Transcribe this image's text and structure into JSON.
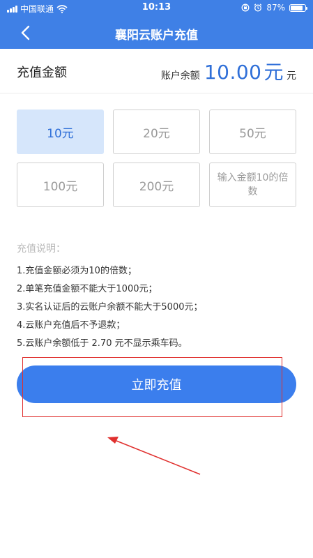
{
  "status_bar": {
    "carrier": "中国联通",
    "time": "10:13",
    "battery": "87%",
    "battery_level": 0.87,
    "icons": [
      "signal-icon",
      "wifi-icon",
      "rotation-lock-icon",
      "alarm-icon",
      "battery-icon"
    ]
  },
  "nav": {
    "title": "襄阳云账户充值",
    "back_icon": "chevron-left-icon"
  },
  "amount": {
    "label": "充值金额",
    "balance_label": "账户余额",
    "balance_value": "10.00",
    "balance_unit_large": "元",
    "balance_unit": "元"
  },
  "options": [
    {
      "label": "10元",
      "selected": true
    },
    {
      "label": "20元",
      "selected": false
    },
    {
      "label": "50元",
      "selected": false
    },
    {
      "label": "100元",
      "selected": false
    },
    {
      "label": "200元",
      "selected": false
    },
    {
      "label": "输入金额10的倍数",
      "selected": false
    }
  ],
  "description": {
    "title": "充值说明：",
    "items": [
      "1.充值金额必须为10的倍数；",
      "2.单笔充值金额不能大于1000元；",
      "3.实名认证后的云账户余额不能大于5000元；",
      "4.云账户充值后不予退款；",
      "5.云账户余额低于 2.70 元不显示乘车码。"
    ]
  },
  "submit": {
    "label": "立即充值"
  },
  "colors": {
    "header": "#3f80e6",
    "accent": "#2f6fd8",
    "button": "#3b7eed",
    "selected_bg": "#d6e6fb",
    "annotation": "#e0302e"
  }
}
